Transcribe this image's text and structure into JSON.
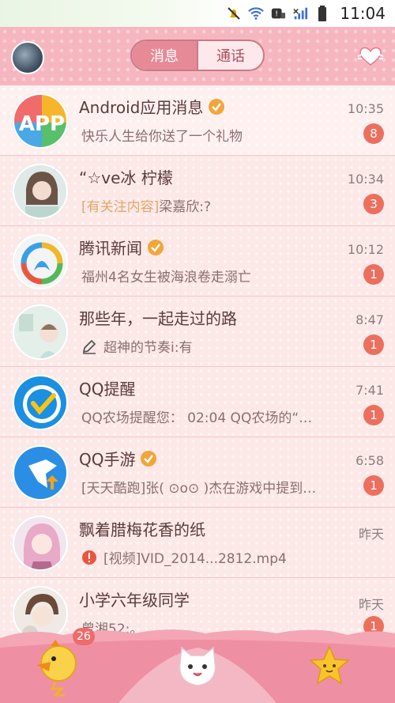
{
  "status_bar": {
    "time": "11:04"
  },
  "header": {
    "tabs": [
      {
        "label": "消息",
        "active": true
      },
      {
        "label": "通话",
        "active": false
      }
    ]
  },
  "conversations": [
    {
      "name": "Android应用消息",
      "verified": true,
      "preview": "快乐人生给你送了一个礼物",
      "time": "10:35",
      "unread": "8",
      "avatar_icon": "app-icon"
    },
    {
      "name": "“☆ve冰 柠檬",
      "verified": false,
      "preview_tag": "[有关注内容]",
      "preview": "梁嘉欣:?",
      "time": "10:34",
      "unread": "3",
      "avatar_icon": "girl-photo-avatar"
    },
    {
      "name": "腾讯新闻",
      "verified": true,
      "preview": "福州4名女生被海浪卷走溺亡",
      "time": "10:12",
      "unread": "1",
      "avatar_icon": "tencent-news-icon"
    },
    {
      "name": "那些年，一起走过的路",
      "verified": false,
      "preview": "超神的节奏i:有",
      "time": "8:47",
      "unread": "1",
      "avatar_icon": "group-photo-avatar",
      "preview_icon": "pencil-icon"
    },
    {
      "name": "QQ提醒",
      "verified": false,
      "preview": "QQ农场提醒您： 02:04  QQ农场的“…",
      "time": "7:41",
      "unread": "1",
      "avatar_icon": "qq-reminder-icon"
    },
    {
      "name": "QQ手游",
      "verified": true,
      "preview": "[天天酷跑]张( ⊙o⊙ )杰在游戏中提到…",
      "time": "6:58",
      "unread": "1",
      "avatar_icon": "qq-games-icon"
    },
    {
      "name": "飘着腊梅花香的纸",
      "verified": false,
      "preview": "[视频]VID_2014...2812.mp4",
      "time": "昨天",
      "unread": "",
      "avatar_icon": "anime-girl-avatar",
      "preview_icon": "error-icon"
    },
    {
      "name": "小学六年级同学",
      "verified": false,
      "preview": "曾湘52:。",
      "time": "昨天",
      "unread": "1",
      "avatar_icon": "boy-cat-avatar"
    }
  ],
  "bottom_bar": {
    "messages_count": "26"
  },
  "colors": {
    "accent": "#e68a98",
    "badge": "#ec6f5e",
    "verified": "#f2a53a"
  }
}
